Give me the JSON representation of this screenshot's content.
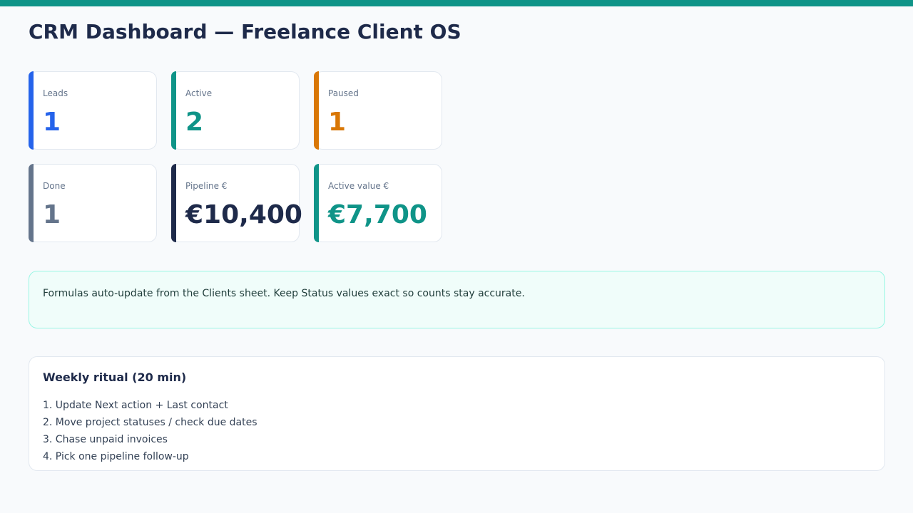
{
  "header": {
    "title": "CRM Dashboard — Freelance Client OS"
  },
  "colors": {
    "topbar": "#0f9488",
    "blue": "#2563eb",
    "teal": "#0f9488",
    "orange": "#d97706",
    "slate": "#64748b",
    "navy": "#1e2a4a"
  },
  "kpis": [
    {
      "label": "Leads",
      "value": "1"
    },
    {
      "label": "Active",
      "value": "2"
    },
    {
      "label": "Paused",
      "value": "1"
    },
    {
      "label": "Done",
      "value": "1"
    },
    {
      "label": "Pipeline €",
      "value": "€10,400"
    },
    {
      "label": "Active value €",
      "value": "€7,700"
    }
  ],
  "notice": {
    "text": "Formulas auto-update from the Clients sheet. Keep Status values exact so counts stay accurate."
  },
  "ritual": {
    "title": "Weekly ritual (20 min)",
    "items": [
      "1. Update Next action + Last contact",
      "2. Move project statuses / check due dates",
      "3. Chase unpaid invoices",
      "4. Pick one pipeline follow-up"
    ]
  }
}
